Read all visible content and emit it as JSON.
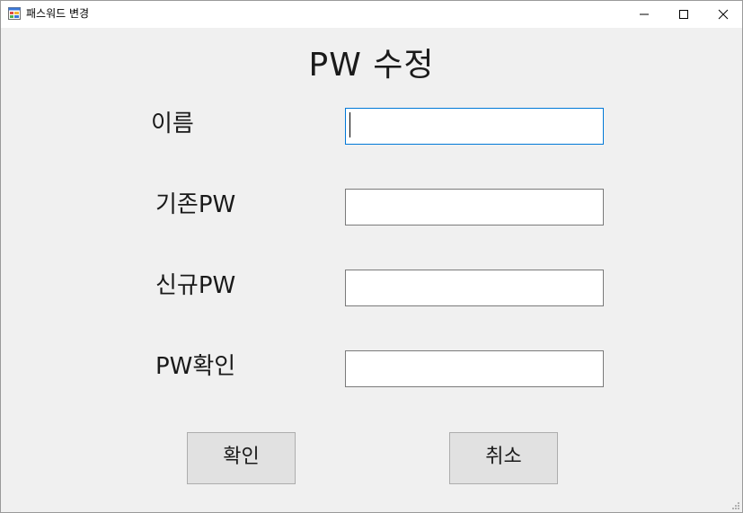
{
  "window": {
    "title": "패스워드 변경",
    "icon": "form-app-icon"
  },
  "form": {
    "heading": "PW 수정",
    "fields": [
      {
        "label": "이름",
        "value": ""
      },
      {
        "label": "기존PW",
        "value": ""
      },
      {
        "label": "신규PW",
        "value": ""
      },
      {
        "label": "PW확인",
        "value": ""
      }
    ],
    "confirm_button": "확인",
    "cancel_button": "취소"
  },
  "colors": {
    "focus_border": "#0078d7",
    "client_bg": "#f0f0f0",
    "button_bg": "#e1e1e1"
  }
}
